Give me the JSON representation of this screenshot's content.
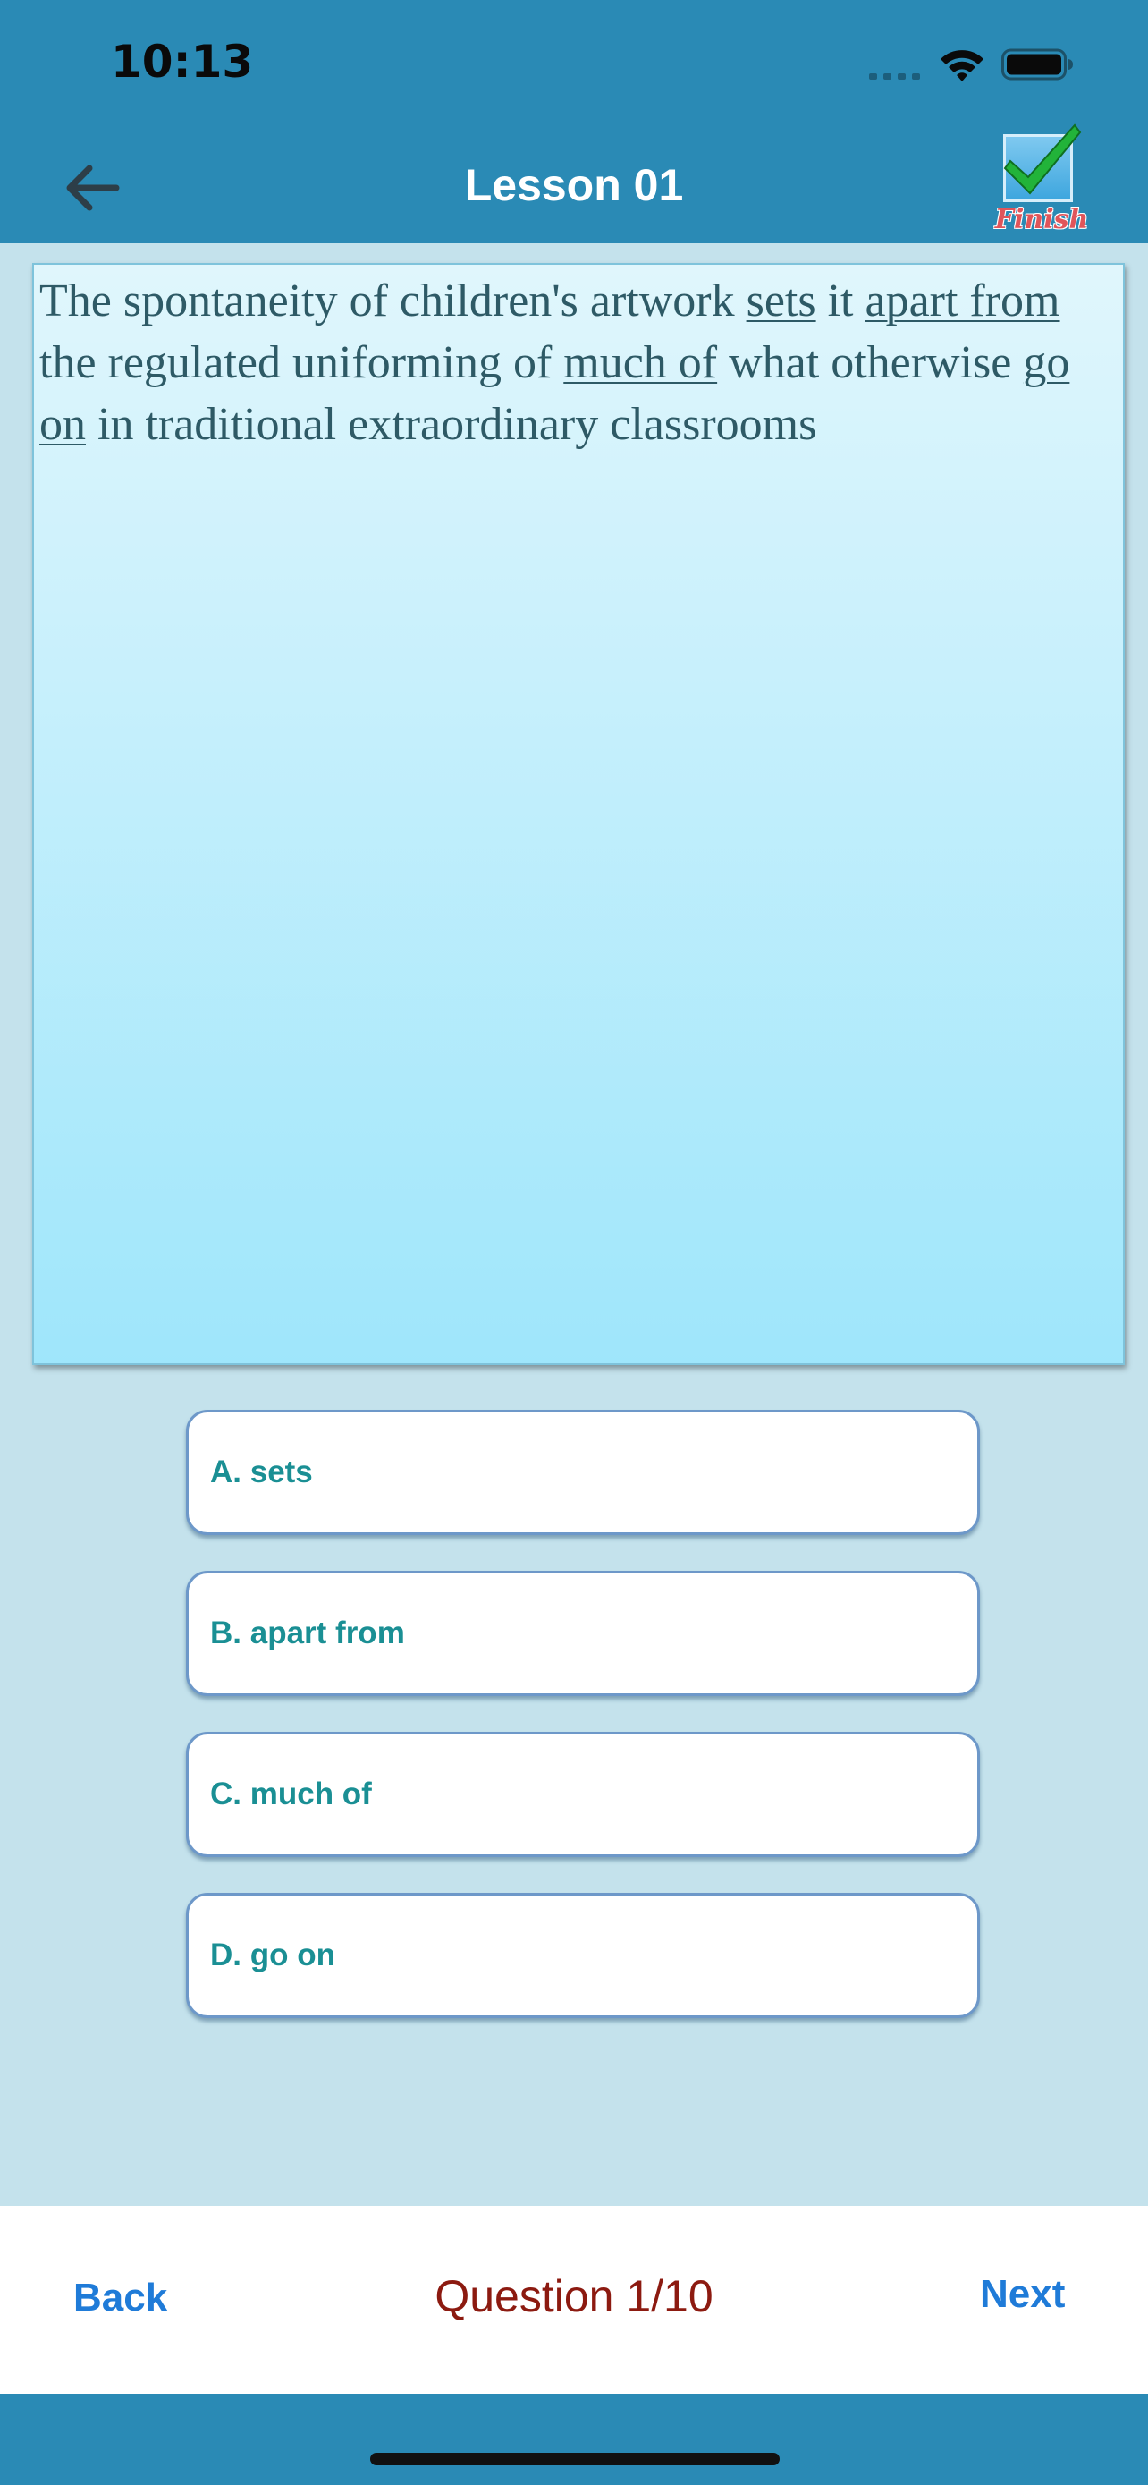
{
  "status_bar": {
    "time": "10:13",
    "icons": [
      "cellular-signal-icon",
      "wifi-icon",
      "battery-icon"
    ]
  },
  "nav": {
    "title": "Lesson 01",
    "back_icon": "arrow-left-icon",
    "finish_label": "Finish",
    "finish_icon": "checkmark-icon"
  },
  "question": {
    "segments": [
      {
        "text": "The spontaneity of children's artwork ",
        "underline": false
      },
      {
        "text": "sets",
        "underline": true
      },
      {
        "text": " it ",
        "underline": false
      },
      {
        "text": "apart from",
        "underline": true
      },
      {
        "text": " the regulated uniforming of ",
        "underline": false
      },
      {
        "text": "much of",
        "underline": true
      },
      {
        "text": " what otherwise ",
        "underline": false
      },
      {
        "text": "go on",
        "underline": true
      },
      {
        "text": " in traditional extraordinary classrooms",
        "underline": false
      }
    ]
  },
  "options": [
    {
      "label": "A. sets"
    },
    {
      "label": "B. apart from"
    },
    {
      "label": "C. much of"
    },
    {
      "label": "D. go on"
    }
  ],
  "footer": {
    "back_label": "Back",
    "counter": "Question 1/10",
    "next_label": "Next"
  },
  "colors": {
    "header_bg": "#2a8ab5",
    "page_bg": "#c4e2ec",
    "question_text": "#2e5a66",
    "option_text": "#1a8f94",
    "counter_text": "#8c1a10",
    "link_blue": "#1f7bd8"
  }
}
